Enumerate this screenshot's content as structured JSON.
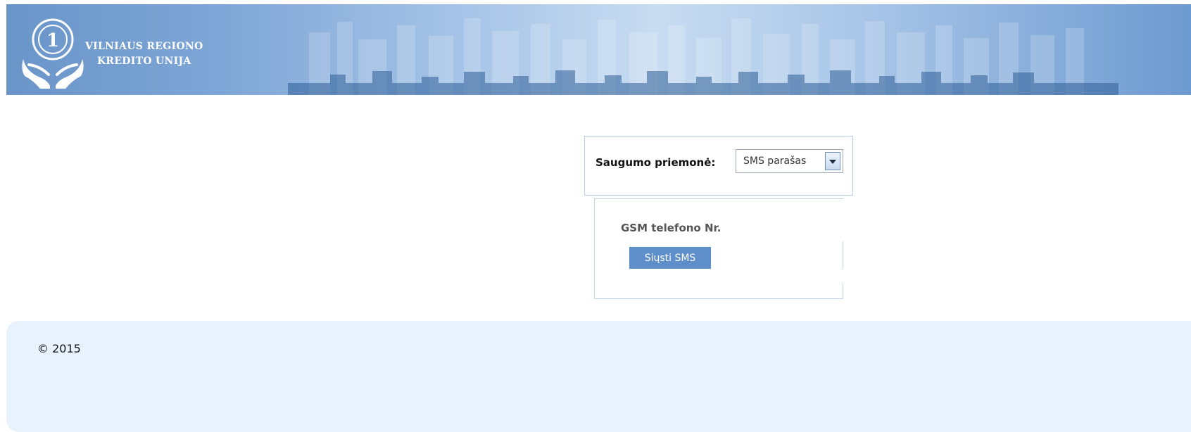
{
  "header": {
    "brand_line1": "VILNIAUS REGIONO",
    "brand_line2": "KREDITO UNIJA",
    "logo_icon": "hands-holding-coin-icon",
    "logo_number": "1"
  },
  "security": {
    "label": "Saugumo priemonė:",
    "selected": "SMS parašas"
  },
  "sms": {
    "phone_label": "GSM telefono Nr.",
    "send_button": "Siųsti SMS"
  },
  "footer": {
    "copyright": "© 2015"
  },
  "colors": {
    "banner": "#7ea6d6",
    "button": "#5e8fca",
    "footer_bg": "#e8f2fc"
  }
}
